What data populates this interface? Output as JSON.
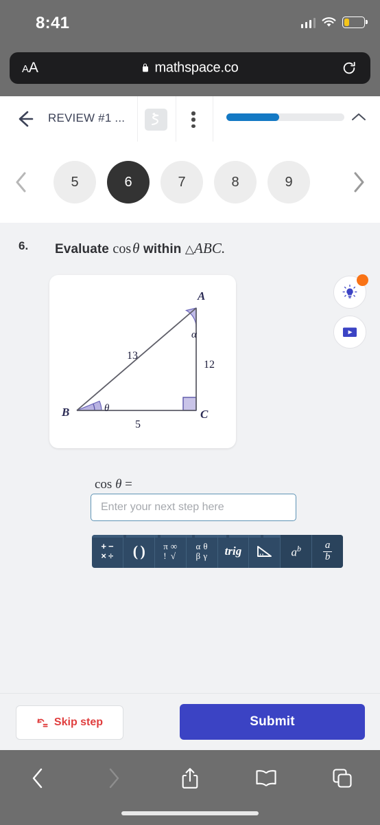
{
  "status_bar": {
    "time": "8:41",
    "signal_icon": "cellular-signal-icon",
    "wifi_icon": "wifi-icon",
    "battery_icon": "battery-low-icon"
  },
  "browser": {
    "text_size_label": "AA",
    "lock_icon": "lock-icon",
    "url": "mathspace.co",
    "reload_icon": "reload-icon",
    "bottom_bar": {
      "back_icon": "back-chevron-icon",
      "forward_icon": "forward-chevron-icon",
      "share_icon": "share-icon",
      "bookmarks_icon": "book-icon",
      "tabs_icon": "tabs-icon"
    }
  },
  "app_header": {
    "back_icon": "back-arrow-icon",
    "title": "REVIEW #1 ...",
    "notes_icon": "scribble-notes-icon",
    "menu_icon": "more-vertical-icon",
    "progress_percent": 45,
    "collapse_icon": "chevron-up-icon"
  },
  "pager": {
    "prev_icon": "chevron-left-icon",
    "next_icon": "chevron-right-icon",
    "steps": [
      {
        "label": "5",
        "active": false
      },
      {
        "label": "6",
        "active": true
      },
      {
        "label": "7",
        "active": false
      },
      {
        "label": "8",
        "active": false
      },
      {
        "label": "9",
        "active": false
      }
    ]
  },
  "question": {
    "number": "6.",
    "prompt_pre": "Evaluate ",
    "prompt_fn": "cos",
    "prompt_theta": "θ",
    "prompt_mid": " within ",
    "prompt_triangle": "△",
    "prompt_vertices": "ABC",
    "prompt_end": "."
  },
  "diagram": {
    "type": "right-triangle",
    "vertices": [
      "A",
      "B",
      "C"
    ],
    "side_labels": {
      "hypotenuse": "13",
      "vertical": "12",
      "horizontal": "5"
    },
    "angle_labels": {
      "at_A": "α",
      "at_B": "θ",
      "at_C": "right-angle"
    },
    "accent_color": "#b5b0de",
    "line_color": "#5b5b66"
  },
  "help": {
    "hint_icon": "lightbulb-hint-icon",
    "hint_badge_color": "#f97316",
    "video_icon": "video-play-icon"
  },
  "answer": {
    "label_fn": "cos",
    "label_theta": "θ",
    "label_eq": "=",
    "placeholder": "Enter your next step here",
    "value": ""
  },
  "keypad": {
    "background": "#2f4a66",
    "buttons": [
      {
        "name": "operators-key",
        "kind": "ops",
        "glyphs": [
          "+",
          "−",
          "×",
          "÷"
        ]
      },
      {
        "name": "parentheses-key",
        "kind": "paren",
        "label": "( )"
      },
      {
        "name": "constants-key",
        "kind": "grk",
        "glyphs": [
          "π",
          "∞",
          "!",
          "√"
        ]
      },
      {
        "name": "greek-letters-key",
        "kind": "grk",
        "glyphs": [
          "α",
          "θ",
          "β",
          "γ"
        ]
      },
      {
        "name": "trig-key",
        "kind": "trig",
        "label": "trig"
      },
      {
        "name": "geometry-key",
        "kind": "icon",
        "label": "triangle-ruler-icon"
      },
      {
        "name": "exponent-key",
        "kind": "ab",
        "base": "a",
        "exp": "b"
      },
      {
        "name": "fraction-key",
        "kind": "frac",
        "numerator": "a",
        "denominator": "b"
      }
    ]
  },
  "actions": {
    "skip_icon": "skip-step-icon",
    "skip_label": "Skip step",
    "skip_color": "#e03e3e",
    "submit_label": "Submit",
    "submit_color": "#3b43c4"
  }
}
